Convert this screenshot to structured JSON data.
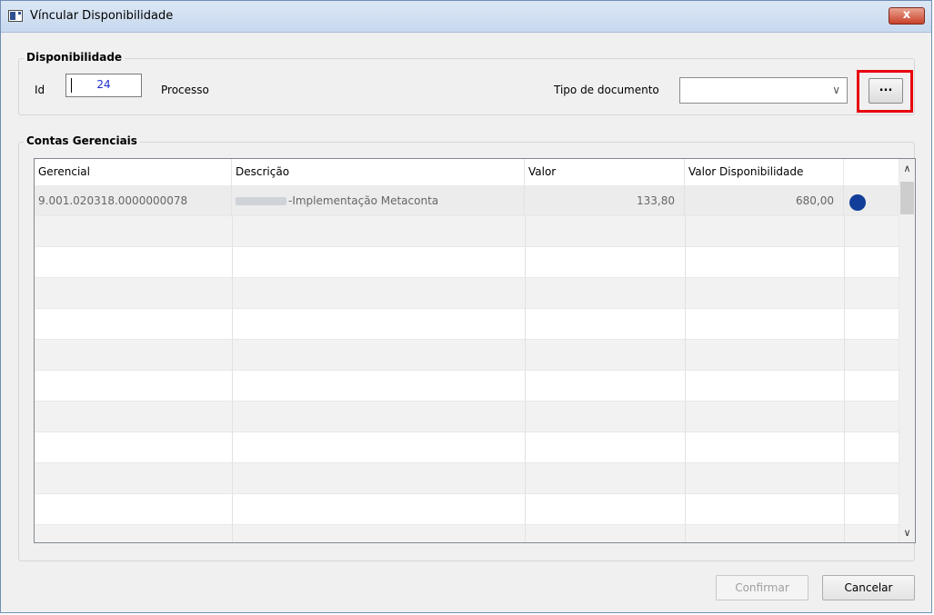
{
  "window": {
    "title": "Víncular Disponibilidade",
    "close_label": "x"
  },
  "disponibilidade": {
    "group_title": "Disponibilidade",
    "id_label": "Id",
    "id_value": "24",
    "processo_label": "Processo",
    "tipo_documento_label": "Tipo de documento",
    "tipo_documento_value": "",
    "browse_label": "..."
  },
  "contas": {
    "group_title": "Contas Gerenciais",
    "columns": [
      "Gerencial",
      "Descrição",
      "Valor",
      "Valor Disponibilidade"
    ],
    "rows": [
      {
        "gerencial": "9.001.020318.0000000078",
        "descricao": "-Implementação Metaconta",
        "valor": "133,80",
        "valor_disponibilidade": "680,00",
        "status_color": "#123e99"
      }
    ]
  },
  "footer": {
    "confirm_label": "Confirmar",
    "cancel_label": "Cancelar"
  },
  "colors": {
    "highlight": "#e8000d",
    "status_dot": "#123e99"
  }
}
